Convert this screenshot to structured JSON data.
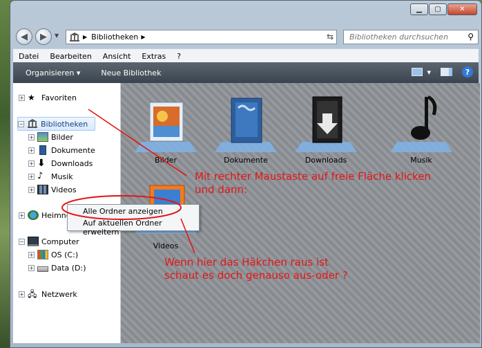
{
  "window": {
    "address": {
      "crumb": "Bibliotheken"
    },
    "search": {
      "placeholder": "Bibliotheken durchsuchen"
    },
    "menu": [
      "Datei",
      "Bearbeiten",
      "Ansicht",
      "Extras",
      "?"
    ],
    "commands": {
      "organize": "Organisieren",
      "new_library": "Neue Bibliothek"
    }
  },
  "sidebar": {
    "favorites": "Favoriten",
    "libraries": "Bibliotheken",
    "library_items": [
      "Bilder",
      "Dokumente",
      "Downloads",
      "Musik",
      "Videos"
    ],
    "homegroup": "Heimnetzgruppe",
    "computer": "Computer",
    "drives": [
      "OS (C:)",
      "Data (D:)"
    ],
    "network": "Netzwerk"
  },
  "content": {
    "tiles": [
      "Bilder",
      "Dokumente",
      "Downloads",
      "Musik",
      "Videos"
    ]
  },
  "context_menu": {
    "items": [
      "Alle Ordner anzeigen",
      "Auf aktuellen Ordner erweitern"
    ]
  },
  "annotations": {
    "top_line1": "Mit rechter Maustaste auf freie Fläche klicken",
    "top_line2": "und dann:",
    "bottom_line1": "Wenn hier das Häkchen raus ist",
    "bottom_line2": "schaut es doch genauso aus-oder ?"
  },
  "colors": {
    "annotation_red": "#e31616",
    "cmdbar": "#4a535d",
    "content_bg": "#8f9398"
  }
}
